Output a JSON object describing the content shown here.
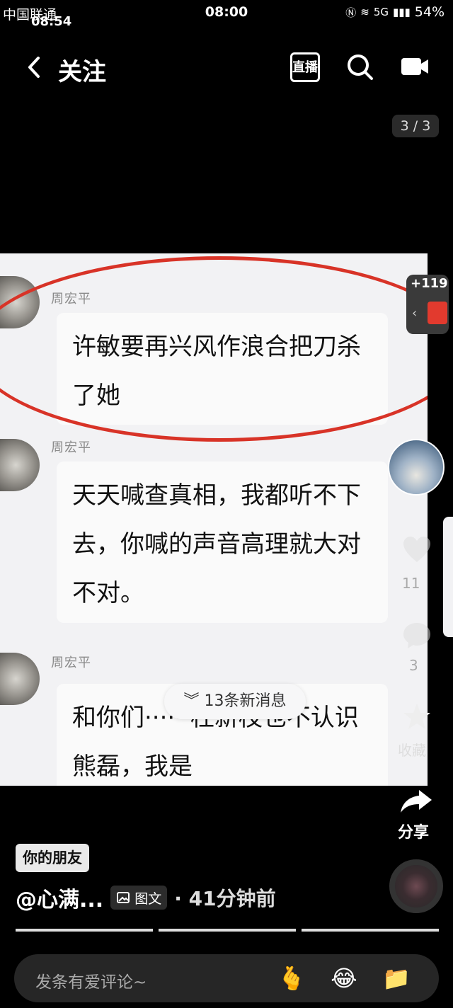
{
  "status_bar": {
    "carrier": "中国联通",
    "time_left": "08:54",
    "time_center": "08:00",
    "network": "5G",
    "battery": "54%"
  },
  "nav": {
    "title": "关注",
    "live_label": "直播"
  },
  "page_counter": "3 / 3",
  "chat": {
    "messages": [
      {
        "sender": "周宏平",
        "text": "许敏要再兴风作浪合把刀杀了她"
      },
      {
        "sender": "周宏平",
        "text": "天天喊查真相，我都听不下去，你喊的声音高理就大对不对。"
      },
      {
        "sender": "周宏平",
        "text": "和你们······杜新枝也不认识熊磊，我是"
      }
    ],
    "new_messages": "13条新消息"
  },
  "rail": {
    "redpacket_count": "+119",
    "like_count": "11",
    "comment_count": "3",
    "favorite_label": "收藏",
    "share_label": "分享"
  },
  "post": {
    "friend_tag": "你的朋友",
    "author": "@心满...",
    "type_label": "图文",
    "time": "· 41分钟前"
  },
  "comment": {
    "placeholder": "发条有爱评论~"
  },
  "emojis": [
    "🫰",
    "😂",
    "📁"
  ],
  "colors": {
    "highlight_circle": "#d83327",
    "redpacket": "#e23a2e"
  }
}
